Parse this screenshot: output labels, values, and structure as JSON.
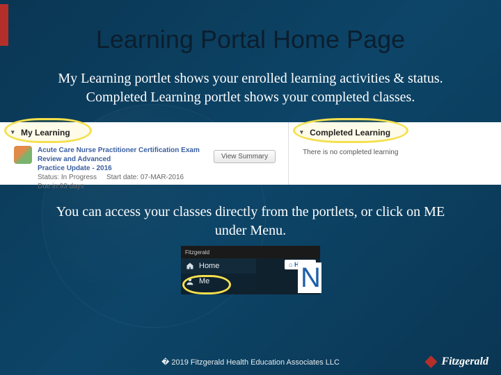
{
  "title": "Learning Portal Home Page",
  "subtitle_line1": "My Learning portlet shows your enrolled learning activities & status.",
  "subtitle_line2": "Completed Learning portlet shows your completed classes.",
  "portlets": {
    "left": {
      "heading": "My Learning",
      "course_title": "Acute Care Nurse Practitioner Certification Exam Review and Advanced",
      "course_sub": "Practice Update - 2016",
      "status_label": "Status: In Progress",
      "start_label": "Start date: 07-MAR-2016",
      "due_label": "Due in 93 days",
      "button": "View Summary"
    },
    "right": {
      "heading": "Completed Learning",
      "empty_text": "There is no completed learning"
    }
  },
  "note_line1": "You can access your classes directly from the portlets, or click on ME",
  "note_line2": "under Menu.",
  "menu": {
    "brand": "Fitzgerald",
    "home_pill": "Home",
    "items": [
      {
        "label": "Home",
        "icon": "home-icon"
      },
      {
        "label": "Me",
        "icon": "user-icon"
      }
    ],
    "big_letter": "N"
  },
  "footer": "� 2019 Fitzgerald Health Education Associates LLC",
  "brand_name": "Fitzgerald",
  "colors": {
    "accent_red": "#b52f2a",
    "highlight": "#f4e04d",
    "bg_dark": "#0b3d5c"
  }
}
